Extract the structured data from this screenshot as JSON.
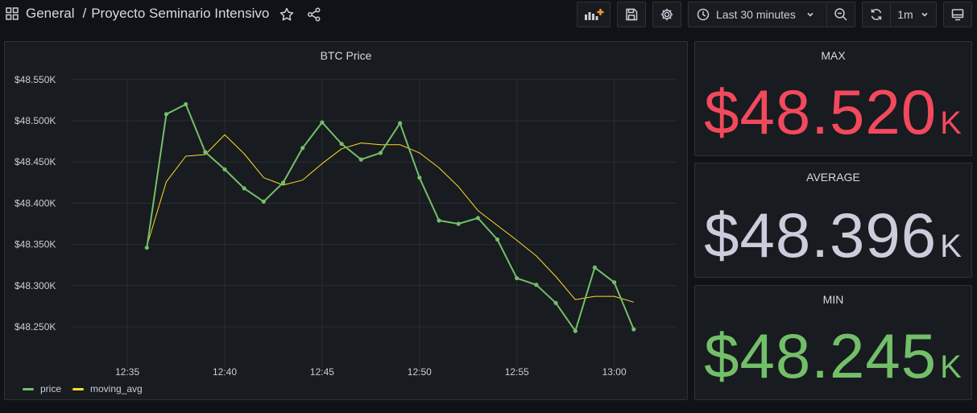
{
  "breadcrumb": {
    "folder": "General",
    "separator": "/",
    "title": "Proyecto Seminario Intensivo"
  },
  "toolbar": {
    "time_range": "Last 30 minutes",
    "refresh_interval": "1m"
  },
  "colors": {
    "price": "#73bf69",
    "moving_avg": "#fade2a",
    "max": "#f2495c",
    "average": "#ccccdc",
    "min": "#73bf69"
  },
  "icons": [
    "apps-icon",
    "star-icon",
    "share-icon",
    "add-panel-icon",
    "save-icon",
    "settings-icon",
    "clock-icon",
    "chevron-down-icon",
    "zoom-out-icon",
    "refresh-icon",
    "tv-mode-icon"
  ],
  "chart_data": {
    "type": "line",
    "title": "BTC Price",
    "xlabel": "",
    "ylabel": "",
    "x_unit": "minutes of clock time (12:36 = 756)",
    "x_ticks": [
      "12:35",
      "12:40",
      "12:45",
      "12:50",
      "12:55",
      "13:00"
    ],
    "x_tick_values": [
      755,
      760,
      765,
      770,
      775,
      780
    ],
    "xlim": [
      752.1,
      783.2
    ],
    "y_ticks": [
      "$48.250K",
      "$48.300K",
      "$48.350K",
      "$48.400K",
      "$48.450K",
      "$48.500K",
      "$48.550K"
    ],
    "y_tick_values": [
      48250,
      48300,
      48350,
      48400,
      48450,
      48500,
      48550
    ],
    "ylim": [
      48250,
      48550
    ],
    "grid": true,
    "legend": "bottom-left",
    "series": [
      {
        "name": "price",
        "points": true,
        "x": [
          756,
          757,
          758,
          759,
          760,
          761,
          762,
          763,
          764,
          765,
          766,
          767,
          768,
          769,
          770,
          771,
          772,
          773,
          774,
          775,
          776,
          777,
          778,
          779,
          780,
          781
        ],
        "values": [
          48346,
          48508,
          48520,
          48462,
          48441,
          48418,
          48402,
          48425,
          48467,
          48498,
          48472,
          48453,
          48461,
          48497,
          48431,
          48379,
          48375,
          48382,
          48356,
          48309,
          48301,
          48279,
          48245,
          48322,
          48304,
          48247
        ]
      },
      {
        "name": "moving_avg",
        "points": false,
        "x": [
          756,
          757,
          758,
          759,
          760,
          761,
          762,
          763,
          764,
          765,
          766,
          767,
          768,
          769,
          770,
          771,
          772,
          773,
          774,
          775,
          776,
          777,
          778,
          779,
          780,
          781
        ],
        "values": [
          48348,
          48426,
          48457,
          48459,
          48483,
          48460,
          48431,
          48422,
          48428,
          48448,
          48466,
          48473,
          48471,
          48471,
          48461,
          48443,
          48420,
          48391,
          48373,
          48355,
          48336,
          48311,
          48283,
          48287,
          48287,
          48280
        ]
      }
    ]
  },
  "stats": [
    {
      "title": "MAX",
      "value": "$48.520",
      "unit": "K"
    },
    {
      "title": "AVERAGE",
      "value": "$48.396",
      "unit": "K"
    },
    {
      "title": "MIN",
      "value": "$48.245",
      "unit": "K"
    }
  ]
}
